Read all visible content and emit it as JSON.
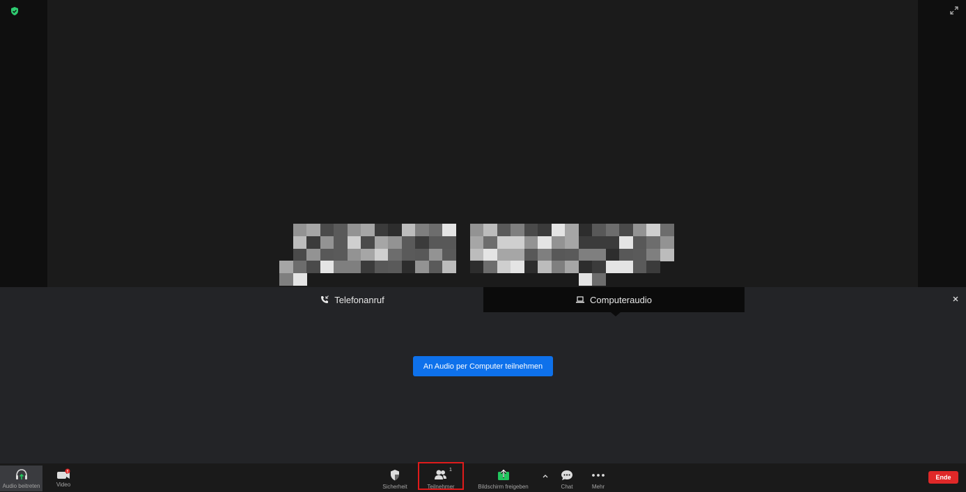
{
  "tabs": {
    "phone_label": "Telefonanruf",
    "computer_label": "Computeraudio"
  },
  "join_button": "An Audio per Computer teilnehmen",
  "toolbar": {
    "audio_label": "Audio beitreten",
    "video_label": "Video",
    "security_label": "Sicherheit",
    "participants_label": "Teilnehmer",
    "participants_count": "1",
    "share_label": "Bildschirm freigeben",
    "chat_label": "Chat",
    "more_label": "Mehr",
    "end_label": "Ende"
  },
  "colors": {
    "accent_blue": "#0e71eb",
    "end_red": "#e02828",
    "share_green": "#22c55e",
    "shield_green": "#2ecc71"
  },
  "icons": [
    "shield-icon",
    "fullscreen-icon",
    "phone-icon",
    "laptop-icon",
    "close-icon",
    "headphones-icon",
    "video-camera-icon",
    "security-shield-icon",
    "participants-icon",
    "share-screen-icon",
    "chevron-up-icon",
    "chat-icon",
    "more-icon"
  ]
}
